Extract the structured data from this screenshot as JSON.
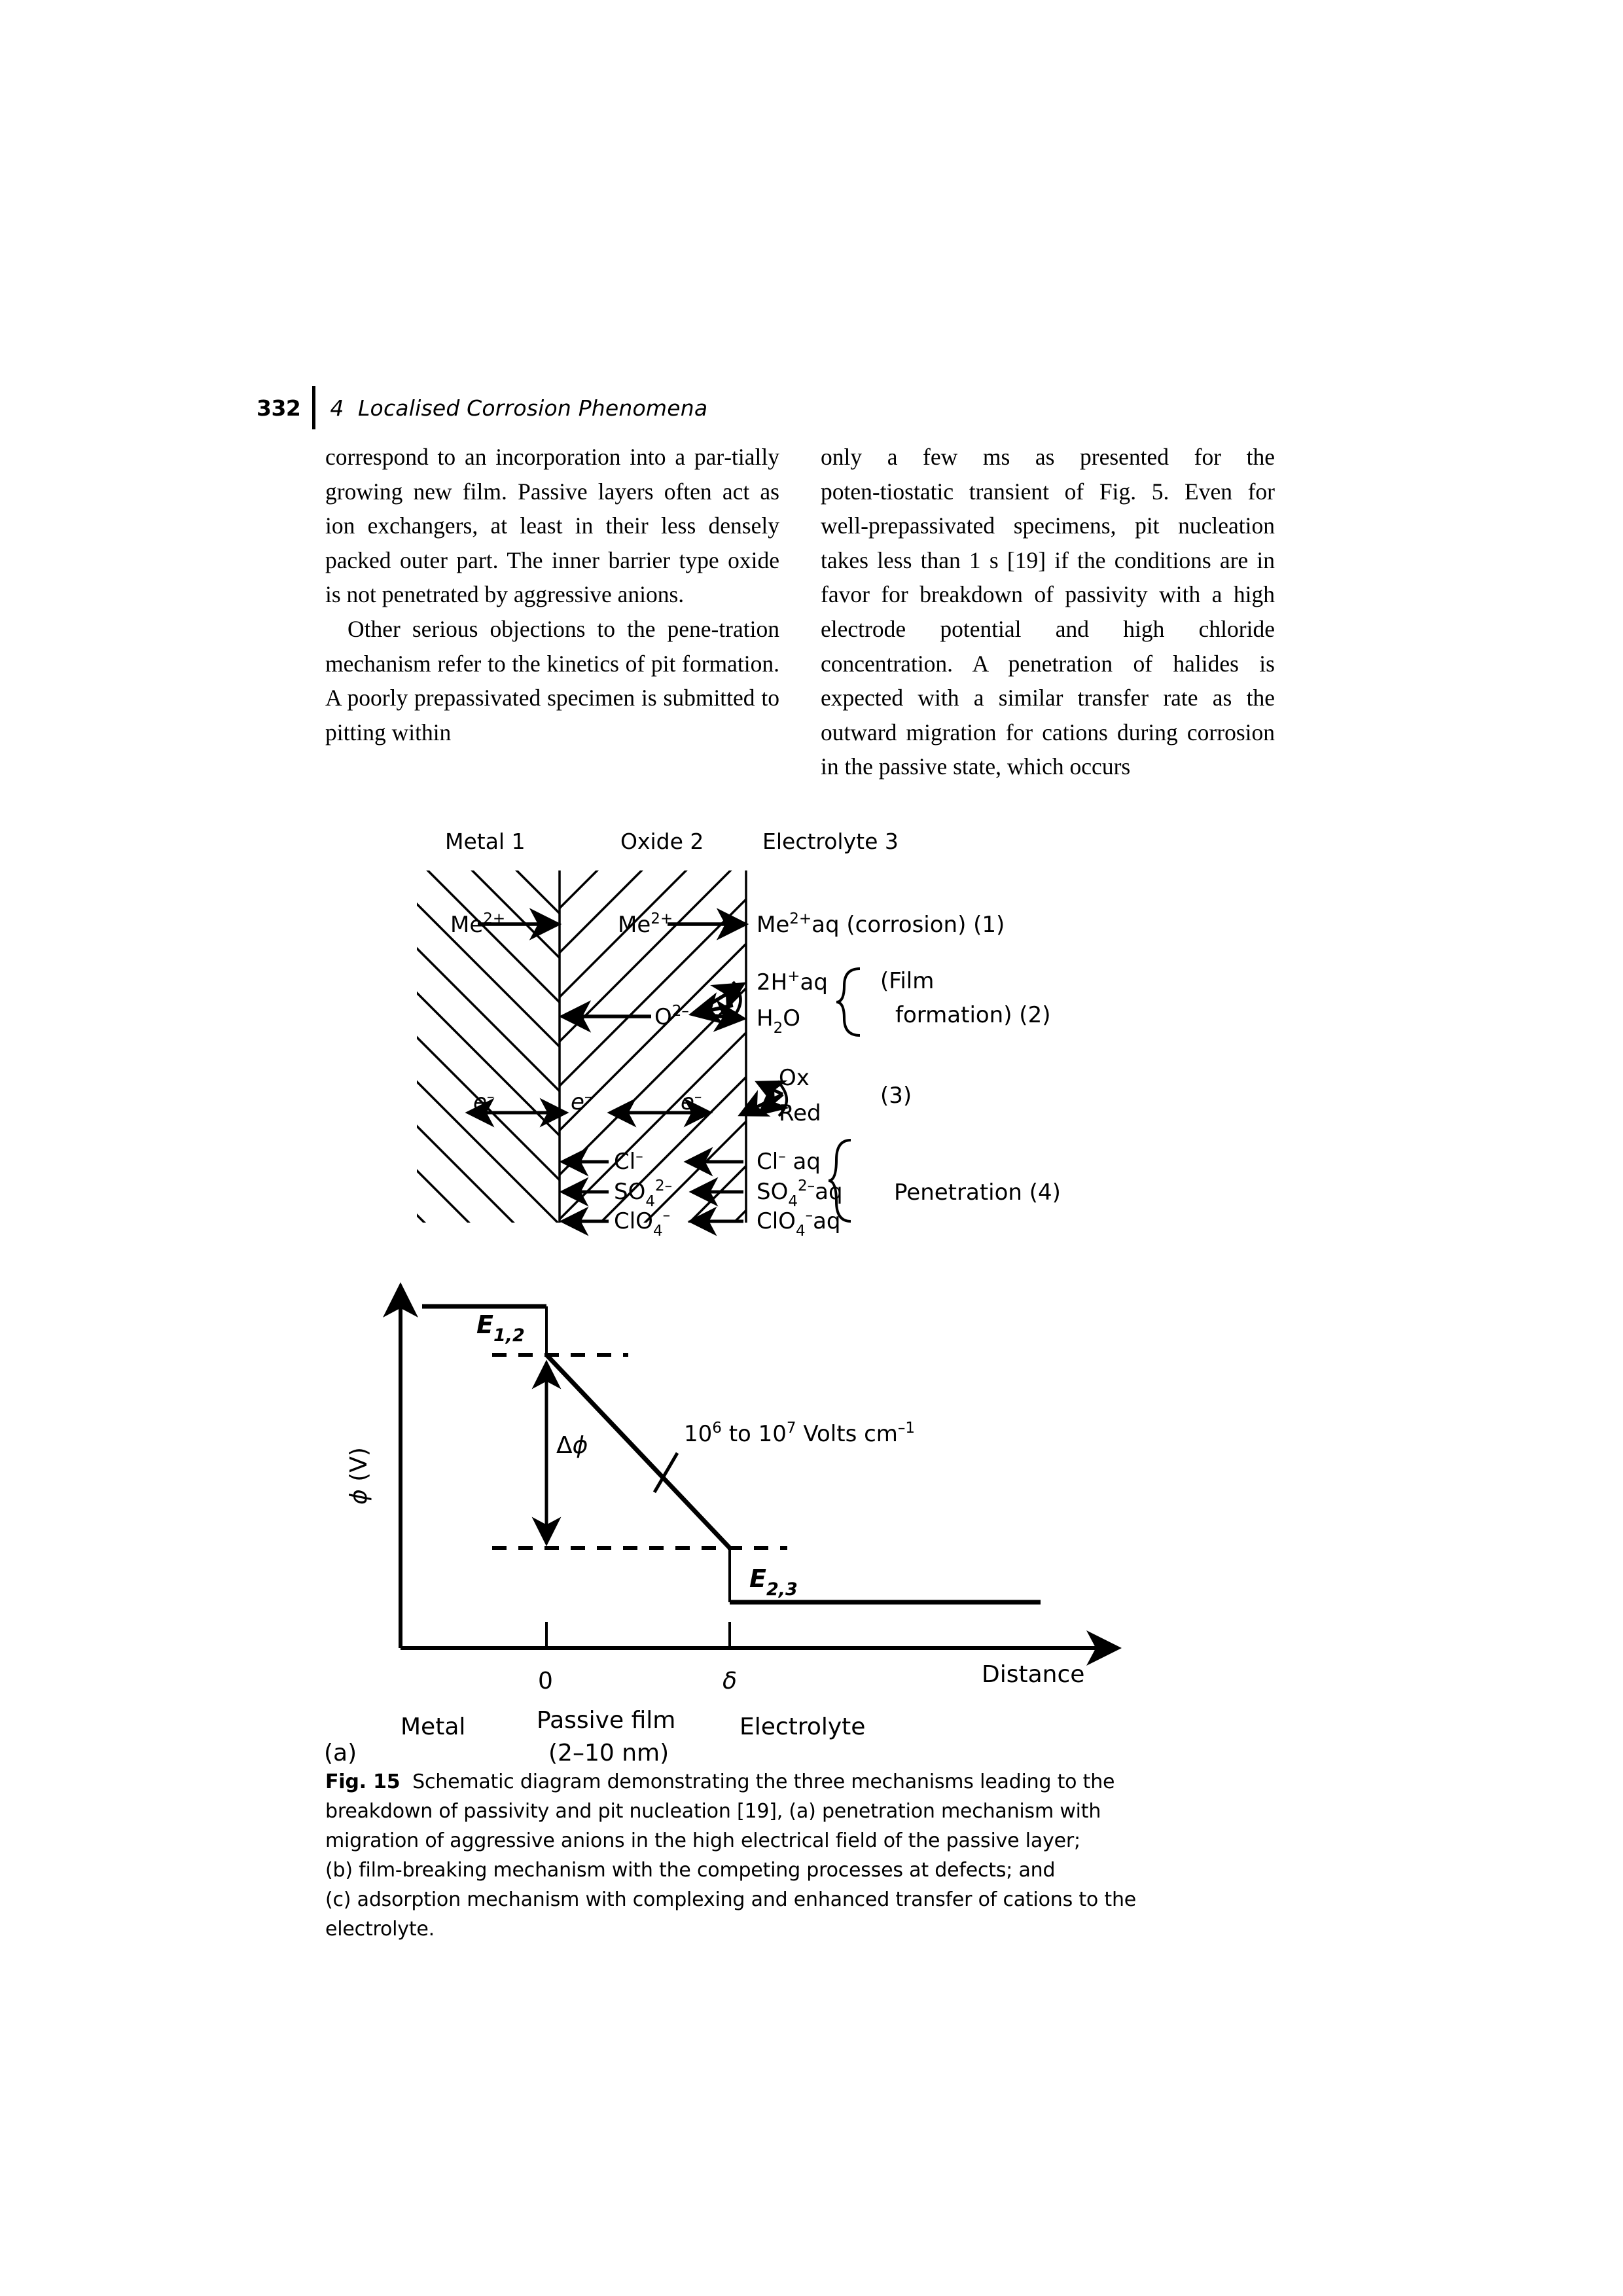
{
  "runhead": {
    "folio": "332",
    "chapter_title": "4  Localised Corrosion Phenomena"
  },
  "body": {
    "left_column": [
      "correspond to an incorporation into a par‑tially growing new film. Passive layers often act as ion exchangers, at least in their less densely packed outer part. The inner barrier type oxide is not penetrated by aggressive anions.",
      "Other serious objections to the pene‑tration mechanism refer to the kinetics of pit formation. A poorly prepassivated specimen is submitted to pitting within"
    ],
    "right_column": [
      "only a few ms as presented for the poten‑tiostatic transient of Fig. 5. Even for well‑prepassivated specimens, pit nucleation takes less than 1 s [19] if the conditions are in favor for breakdown of passivity with a high electrode potential and high chloride concentration. A penetration of halides is expected with a similar transfer rate as the outward migration for cations during corrosion in the passive state, which occurs"
    ]
  },
  "figure": {
    "phase_headers": [
      "Metal 1",
      "Oxide 2",
      "Electrolyte 3"
    ],
    "reactions": [
      {
        "id": "r1",
        "metal": "Me2+",
        "oxide": "Me2+",
        "electrolyte": "Me2+aq",
        "note": "(corrosion) (1)"
      },
      {
        "id": "r2",
        "oxide": "O2-",
        "electrolyte_top": "2H+aq",
        "electrolyte_bottom": "H2O",
        "note_line1": "(Film",
        "note_line2": "formation) (2)"
      },
      {
        "id": "r3",
        "metal": "e-",
        "oxide": "e-",
        "electrolyte_mid": "e-",
        "product_top": "Ox",
        "product_bottom": "Red",
        "note": "(3)"
      },
      {
        "id": "r4",
        "oxide": "Cl-",
        "electrolyte": "Cl- aq"
      },
      {
        "id": "r5",
        "oxide": "SO42-",
        "electrolyte": "SO42-aq"
      },
      {
        "id": "r6",
        "oxide": "ClO4-",
        "electrolyte": "ClO4-aq"
      }
    ],
    "penetration_note": "Penetration (4)",
    "species_labels": {
      "me_base": "Me",
      "me_sup": "2+",
      "aq": "aq",
      "o_base": "O",
      "o_sup": "2–",
      "h_pre": "2H",
      "h_sup": "+",
      "h2o_h": "H",
      "h2o_sub": "2",
      "h2o_o": "O",
      "e_base": "e",
      "e_sup": "–",
      "ox": "Ox",
      "red": "Red",
      "cl_base": "Cl",
      "cl_sup": "–",
      "so4_base": "SO",
      "so4_sub": "4",
      "so4_sup": "2–",
      "clo4_base": "ClO",
      "clo4_sub": "4",
      "clo4_sup": "–"
    }
  },
  "chart_data": {
    "type": "line",
    "title": "",
    "ylabel": "φ (V)",
    "xlabel": "Distance",
    "xtick_labels": [
      "0",
      "δ"
    ],
    "xtick_values": [
      0,
      1
    ],
    "series": [
      {
        "name": "potential profile",
        "x": [
          -0.55,
          0,
          0,
          1,
          1,
          2.4
        ],
        "y": [
          1.0,
          1.0,
          0.835,
          0.18,
          0.0,
          0.0
        ],
        "description": "flat metal potential, step at metal/film interface, linear drop across passive film, step at film/electrolyte interface, flat electrolyte potential"
      }
    ],
    "annotations": [
      {
        "name": "E_1_2",
        "base": "E",
        "sub": "1,2",
        "meaning": "metal/oxide interfacial potential step"
      },
      {
        "name": "delta_phi",
        "text": "Δφ",
        "meaning": "potential drop across the passive film"
      },
      {
        "name": "E_2_3",
        "base": "E",
        "sub": "2,3",
        "meaning": "oxide/electrolyte interfacial potential step"
      },
      {
        "name": "field_strength",
        "prefix": "10",
        "sup1": "6",
        "mid": " to 10",
        "sup2": "7",
        "suffix": " Volts cm",
        "sup3": "–1"
      }
    ],
    "region_labels": [
      {
        "label": "Metal",
        "sublabel": ""
      },
      {
        "label": "Passive film",
        "sublabel": "(2–10 nm)"
      },
      {
        "label": "Electrolyte",
        "sublabel": ""
      }
    ],
    "panel_label": "(a)",
    "grid": false,
    "legend": "none"
  },
  "caption": {
    "fig_number": "Fig. 15",
    "lines": [
      "Schematic diagram demonstrating the three mechanisms leading to the",
      "breakdown of passivity and pit nucleation [19], (a) penetration mechanism with",
      "migration of aggressive anions in the high electrical field of the passive layer;",
      "(b) film-breaking mechanism with the competing processes at defects; and",
      "(c) adsorption mechanism with complexing and enhanced transfer of cations to the",
      "electrolyte."
    ]
  },
  "colors": {
    "ink": "#000000",
    "paper": "#ffffff"
  }
}
